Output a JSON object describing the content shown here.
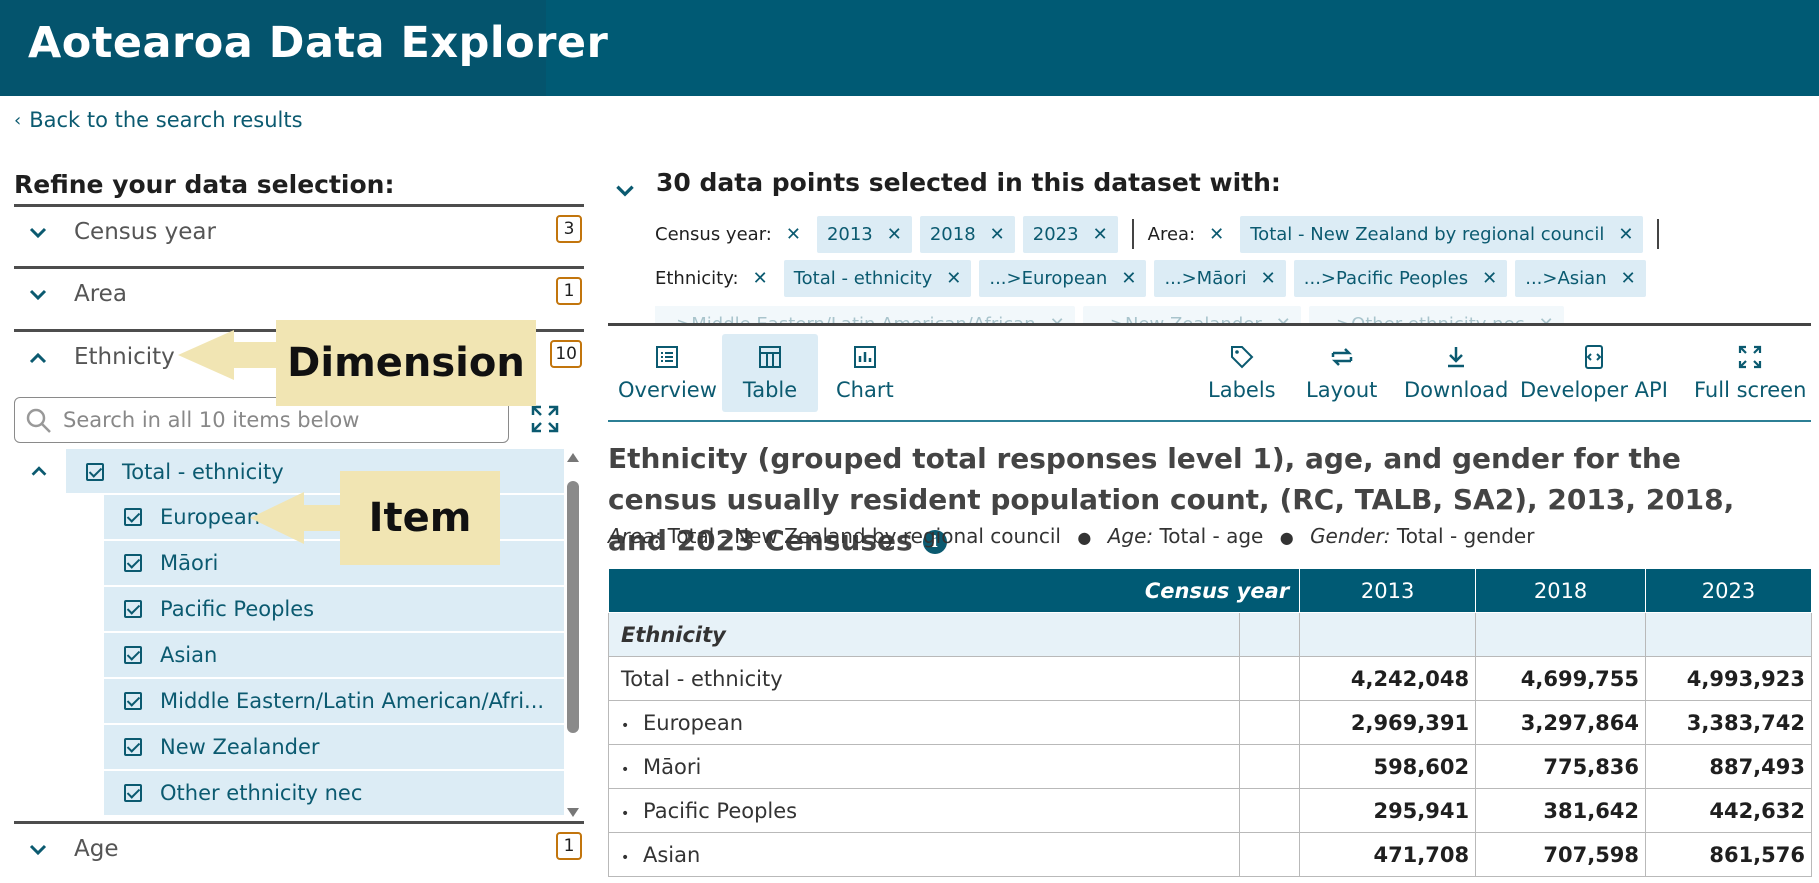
{
  "header": {
    "title": "Aotearoa Data Explorer"
  },
  "nav": {
    "back": "Back to the search results"
  },
  "refine": {
    "title": "Refine your data selection:"
  },
  "dimensions": [
    {
      "label": "Census year",
      "count": "3",
      "expanded": false
    },
    {
      "label": "Area",
      "count": "1",
      "expanded": false
    },
    {
      "label": "Ethnicity",
      "count": "10",
      "expanded": true
    },
    {
      "label": "Age",
      "count": "1",
      "expanded": false
    }
  ],
  "search": {
    "placeholder": "Search in all 10 items below"
  },
  "tree": {
    "parent": "Total - ethnicity",
    "children": [
      "European",
      "Māori",
      "Pacific Peoples",
      "Asian",
      "Middle Eastern/Latin American/Afri...",
      "New Zealander",
      "Other ethnicity nec"
    ]
  },
  "callouts": {
    "dimension": "Dimension",
    "item": "Item"
  },
  "selection": {
    "title": "30 data points selected in this dataset with:",
    "census_label": "Census year:",
    "census_chips": [
      "2013",
      "2018",
      "2023"
    ],
    "area_label": "Area:",
    "area_chips": [
      "Total - New Zealand by regional council"
    ],
    "eth_label": "Ethnicity:",
    "eth_chips": [
      "Total - ethnicity",
      "...>European",
      "...>Māori",
      "...>Pacific Peoples",
      "...>Asian"
    ],
    "eth_chips_row3": [
      "...>Middle Eastern/Latin American/African",
      "...>New Zealander",
      "...>Other ethnicity nec"
    ]
  },
  "toolbar": {
    "overview": "Overview",
    "table": "Table",
    "chart": "Chart",
    "labels": "Labels",
    "layout": "Layout",
    "download": "Download",
    "developer_api": "Developer API",
    "full_screen": "Full screen"
  },
  "content": {
    "title": "Ethnicity (grouped total responses level 1), age, and gender for the census usually resident population count, (RC, TALB, SA2), 2013, 2018, and 2023 Censuses",
    "sub": {
      "area_k": "Area:",
      "area_v": "Total - New Zealand by regional council",
      "age_k": "Age:",
      "age_v": "Total - age",
      "gender_k": "Gender:",
      "gender_v": "Total - gender"
    }
  },
  "table": {
    "header": "Census year",
    "years": [
      "2013",
      "2018",
      "2023"
    ],
    "group": "Ethnicity",
    "rows": [
      {
        "label": "Total - ethnicity",
        "values": [
          "4,242,048",
          "4,699,755",
          "4,993,923"
        ]
      },
      {
        "label": "European",
        "values": [
          "2,969,391",
          "3,297,864",
          "3,383,742"
        ]
      },
      {
        "label": "Māori",
        "values": [
          "598,602",
          "775,836",
          "887,493"
        ]
      },
      {
        "label": "Pacific Peoples",
        "values": [
          "295,941",
          "381,642",
          "442,632"
        ]
      },
      {
        "label": "Asian",
        "values": [
          "471,708",
          "707,598",
          "861,576"
        ]
      }
    ]
  }
}
